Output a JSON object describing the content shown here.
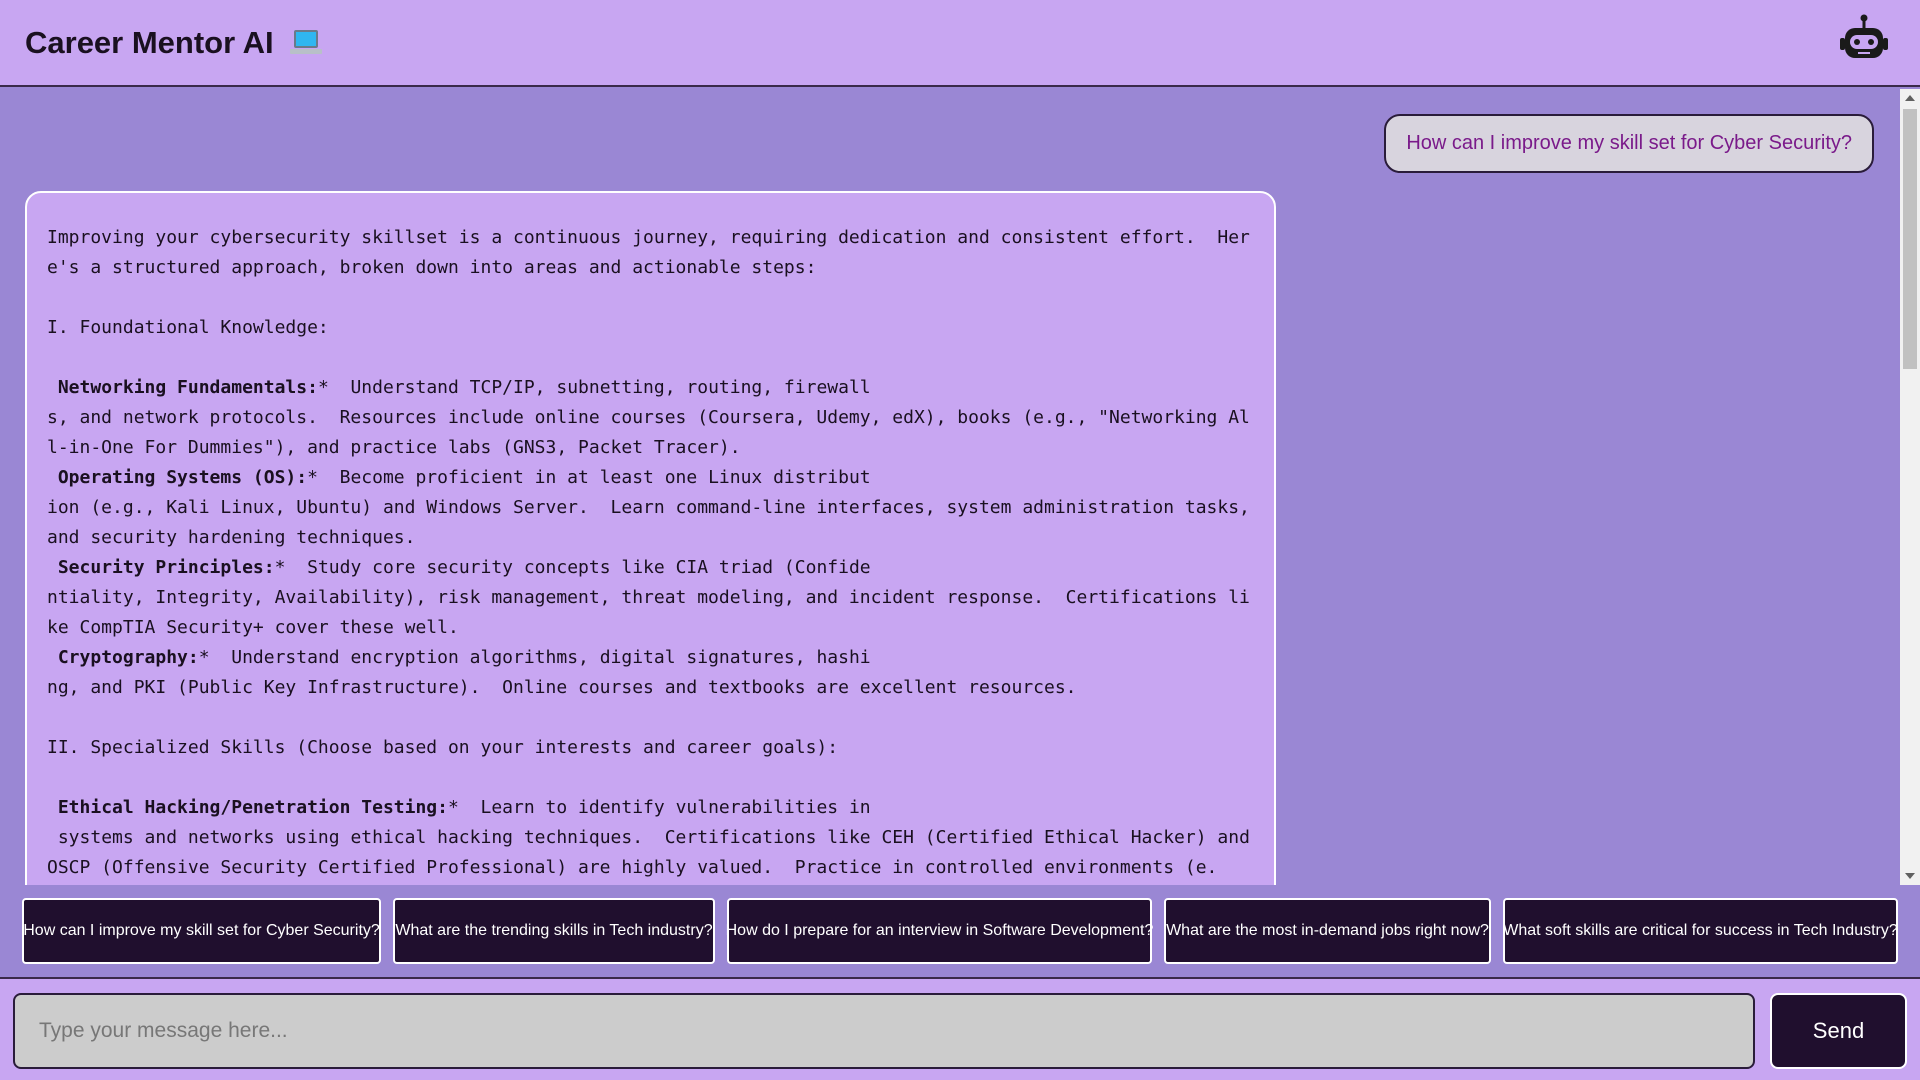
{
  "header": {
    "title": "Career Mentor AI",
    "title_icon": "laptop-icon",
    "avatar_icon": "robot-icon"
  },
  "chat": {
    "user_message": "How can I improve my skill set for Cyber Security?",
    "bot_intro": "Improving your cybersecurity skillset is a continuous journey, requiring dedication and consistent effort.  Here's a structured approach, broken down into areas and actionable steps:",
    "section_1": "I. Foundational Knowledge:",
    "items_1": [
      {
        "term": "Networking Fundamentals:",
        "marker": "*",
        "head": "  Understand TCP/IP, subnetting, routing, firewall",
        "tail": "s, and network protocols.  Resources include online courses (Coursera, Udemy, edX), books (e.g., \"Networking All-in-One For Dummies\"), and practice labs (GNS3, Packet Tracer)."
      },
      {
        "term": "Operating Systems (OS):",
        "marker": "*",
        "head": "  Become proficient in at least one Linux distribut",
        "tail": "ion (e.g., Kali Linux, Ubuntu) and Windows Server.  Learn command-line interfaces, system administration tasks, and security hardening techniques."
      },
      {
        "term": "Security Principles:",
        "marker": "*",
        "head": "  Study core security concepts like CIA triad (Confide",
        "tail": "ntiality, Integrity, Availability), risk management, threat modeling, and incident response.  Certifications like CompTIA Security+ cover these well."
      },
      {
        "term": "Cryptography:",
        "marker": "*",
        "head": "  Understand encryption algorithms, digital signatures, hashi",
        "tail": "ng, and PKI (Public Key Infrastructure).  Online courses and textbooks are excellent resources."
      }
    ],
    "section_2": "II. Specialized Skills (Choose based on your interests and career goals):",
    "items_2": [
      {
        "term": "Ethical Hacking/Penetration Testing:",
        "marker": "*",
        "head": "  Learn to identify vulnerabilities in",
        "tail": " systems and networks using ethical hacking techniques.  Certifications like CEH (Certified Ethical Hacker) and OSCP (Offensive Security Certified Professional) are highly valued.  Practice in controlled environments (e."
      }
    ]
  },
  "suggestions": [
    "How can I improve my skill set for Cyber Security?",
    "What are the trending skills in Tech industry?",
    "How do I prepare for an interview in Software Development?",
    "What are the most in-demand jobs right now?",
    "What soft skills are critical for success in Tech Industry?"
  ],
  "input": {
    "placeholder": "Type your message here...",
    "value": ""
  },
  "send_label": "Send",
  "colors": {
    "header_bg": "#c8a6f2",
    "chat_bg": "#9a87d4",
    "chip_bg": "#200f2e",
    "user_text": "#7a1a8a"
  }
}
